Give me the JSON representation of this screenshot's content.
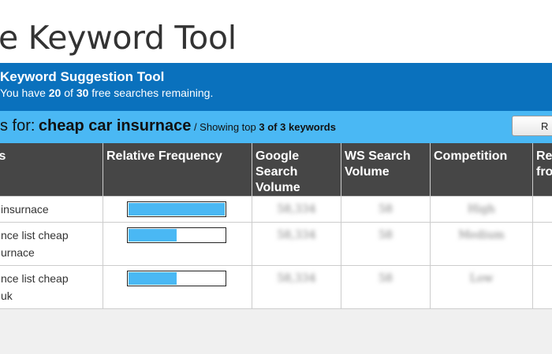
{
  "header": {
    "page_title": "e Keyword Tool",
    "tool_title": "Keyword Suggestion Tool",
    "remaining": {
      "prefix": "You have",
      "used": "20",
      "of": "of",
      "total": "30",
      "suffix": "free searches remaining."
    }
  },
  "results": {
    "prefix": "s for:",
    "keyword": "cheap car insurnace",
    "showing_prefix": " / Showing top",
    "count": "3",
    "of_label": "of",
    "total": "3",
    "keywords_label": "keywords",
    "button_label": "R"
  },
  "table": {
    "headers": [
      "s",
      "Relative Frequency",
      "Google Search Volume",
      "WS Search Volume",
      "Competition",
      "Re fro"
    ],
    "rows": [
      {
        "keyword": "insurnace",
        "frequency": 1.0,
        "google": "58,334",
        "ws": "58",
        "competition": "High"
      },
      {
        "keyword": "nce list cheap\nurnace",
        "frequency": 0.5,
        "google": "58,334",
        "ws": "58",
        "competition": "Medium"
      },
      {
        "keyword": "nce list cheap\nuk",
        "frequency": 0.5,
        "google": "58,334",
        "ws": "58",
        "competition": "Low"
      }
    ]
  },
  "colors": {
    "header_blue": "#0a71bd",
    "results_blue": "#4ab8f4",
    "table_header": "#464646",
    "bar_fill": "#4ab8f4"
  }
}
